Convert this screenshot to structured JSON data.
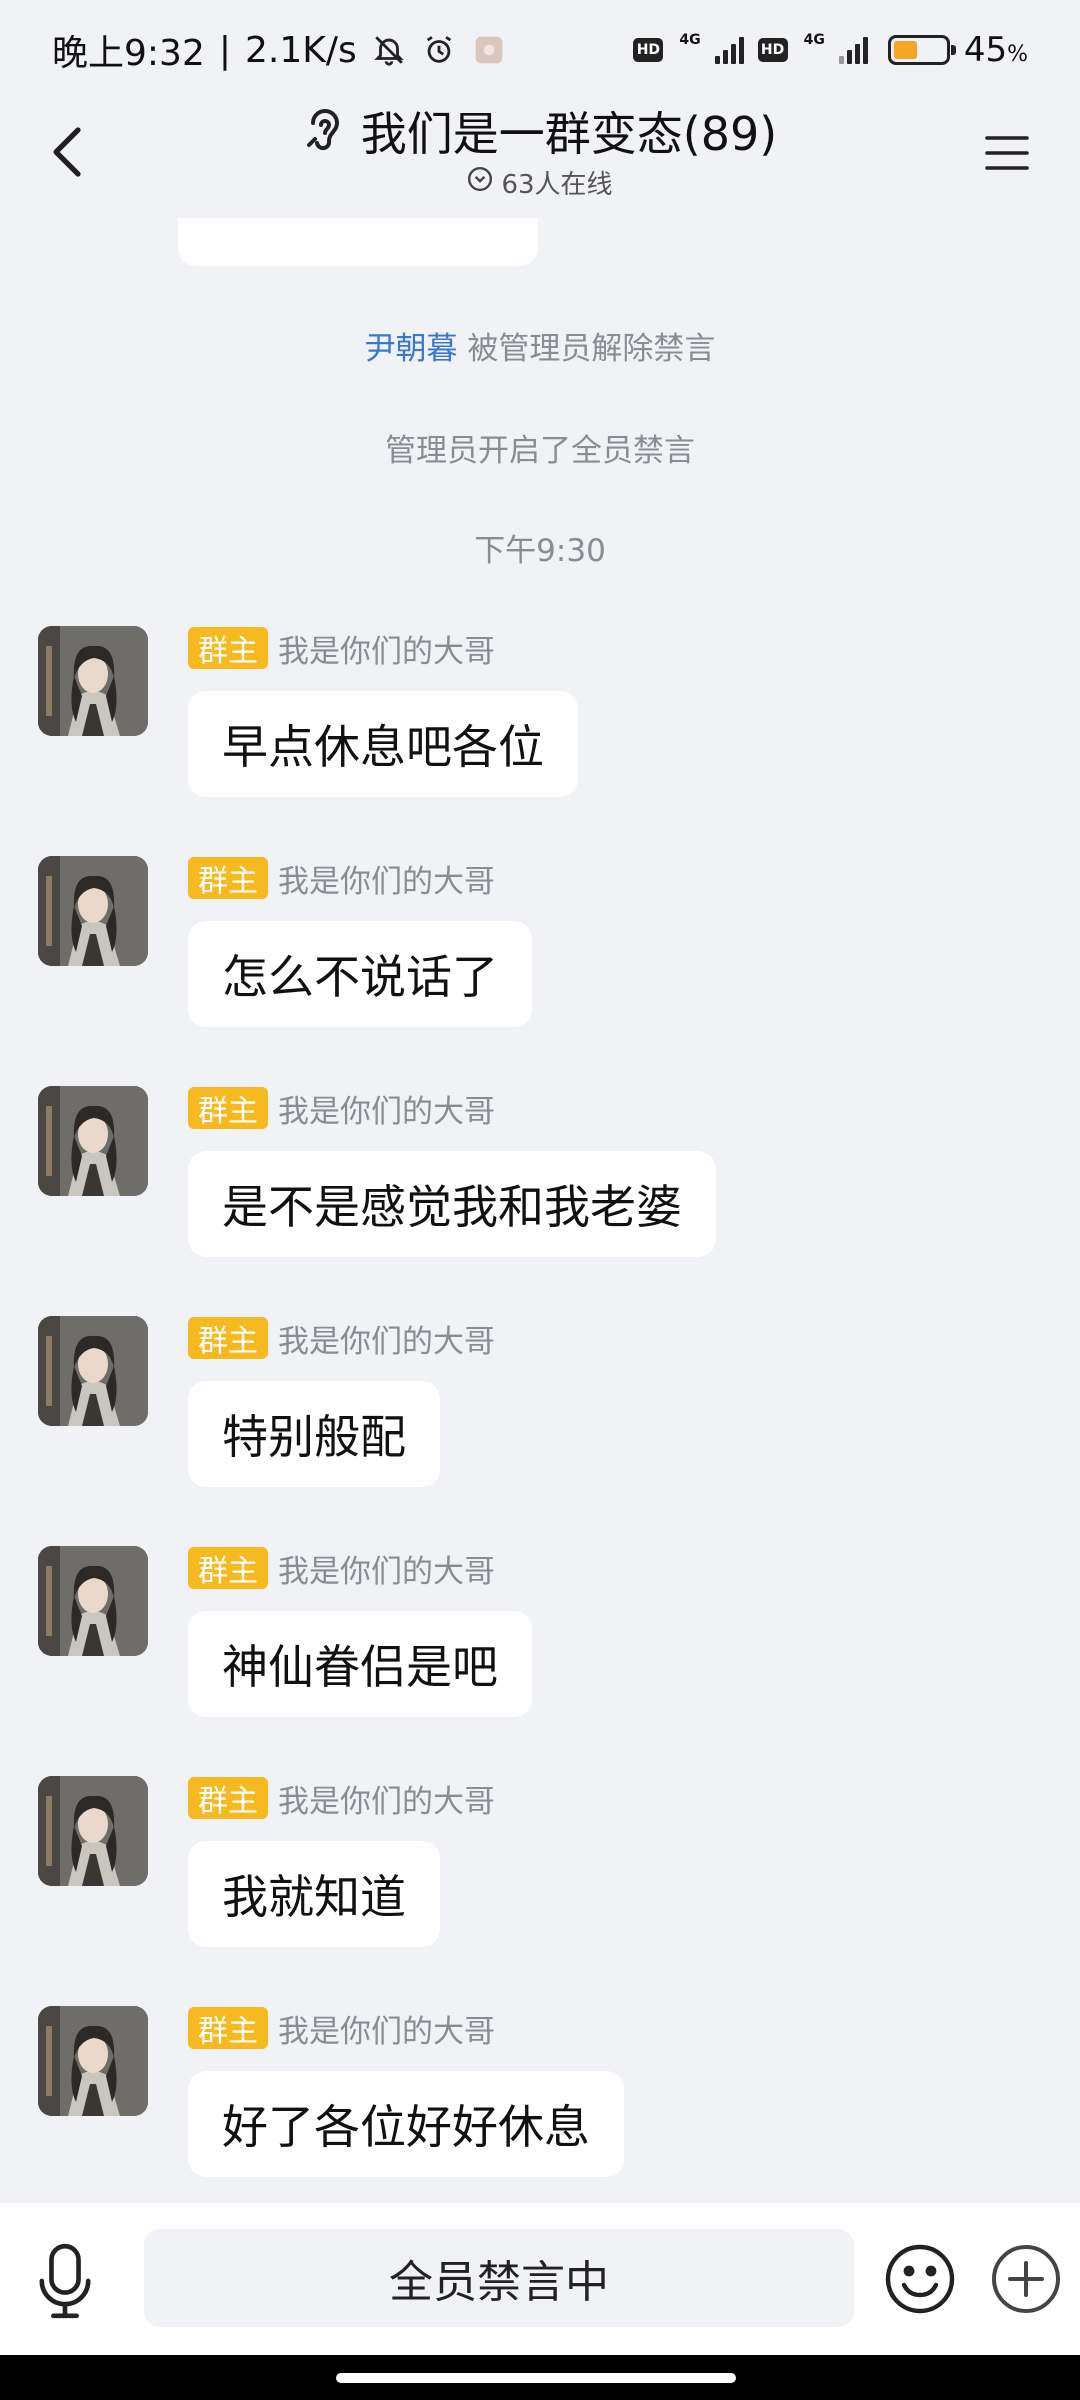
{
  "status_bar": {
    "time": "晚上9:32",
    "net_speed": "2.1K/s",
    "hd_label": "HD",
    "network_type": "4G",
    "battery_percent": 45,
    "battery_text": "45",
    "battery_unit": "%",
    "battery_color": "#f5a623"
  },
  "header": {
    "title": "我们是一群变态(89)",
    "online_status": "63人在线",
    "icons": {
      "back": "back-arrow-icon",
      "ear": "ear-icon",
      "menu": "menu-icon",
      "online": "chevron-circle-icon"
    }
  },
  "system_messages": {
    "unban_name": "尹朝暮",
    "unban_text": "被管理员解除禁言",
    "mute_all": "管理员开启了全员禁言",
    "timestamp": "下午9:30"
  },
  "sender": {
    "badge": "群主",
    "badge_color": "#f6b91f",
    "name": "我是你们的大哥"
  },
  "messages": [
    {
      "text": "早点休息吧各位"
    },
    {
      "text": "怎么不说话了"
    },
    {
      "text": "是不是感觉我和我老婆"
    },
    {
      "text": "特别般配"
    },
    {
      "text": "神仙眷侣是吧"
    },
    {
      "text": "我就知道"
    },
    {
      "text": "好了各位好好休息"
    }
  ],
  "input_bar": {
    "muted_text": "全员禁言中",
    "icons": {
      "mic": "microphone-icon",
      "emoji": "emoji-icon",
      "plus": "plus-circle-icon"
    }
  }
}
